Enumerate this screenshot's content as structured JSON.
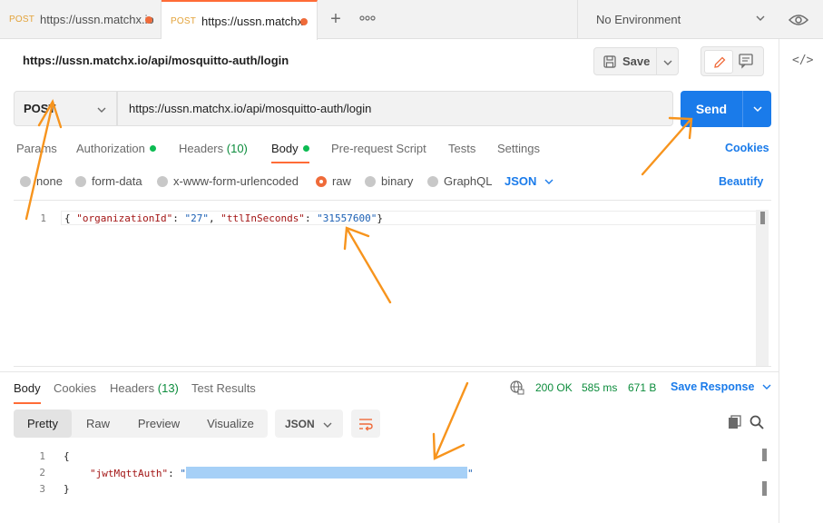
{
  "tabs": [
    {
      "method": "POST",
      "title": "https://ussn.matchx.io/api/mosquitto-auth/login"
    },
    {
      "method": "POST",
      "title": "https://ussn.matchx.io/api/mosquitto-auth/login"
    }
  ],
  "environment": {
    "selected": "No Environment"
  },
  "request": {
    "title": "https://ussn.matchx.io/api/mosquitto-auth/login",
    "save_label": "Save",
    "method": "POST",
    "url": "https://ussn.matchx.io/api/mosquitto-auth/login",
    "send_label": "Send"
  },
  "request_tabs": {
    "params": "Params",
    "authorization": "Authorization",
    "headers": "Headers",
    "headers_count": "(10)",
    "body": "Body",
    "prerequest": "Pre-request Script",
    "tests": "Tests",
    "settings": "Settings",
    "cookies": "Cookies"
  },
  "body_modes": {
    "none": "none",
    "form_data": "form-data",
    "urlencoded": "x-www-form-urlencoded",
    "raw": "raw",
    "binary": "binary",
    "graphql": "GraphQL",
    "language": "JSON",
    "beautify": "Beautify"
  },
  "request_body": {
    "line_number": "1",
    "open_brace": "{",
    "key1": "\"organizationId\"",
    "sep1": ": ",
    "val1": "\"27\"",
    "comma": ", ",
    "key2": "\"ttlInSeconds\"",
    "sep2": ": ",
    "val2": "\"31557600\"",
    "close_brace": "}"
  },
  "response": {
    "tabs": {
      "body": "Body",
      "cookies": "Cookies",
      "headers": "Headers",
      "headers_count": "(13)",
      "test_results": "Test Results"
    },
    "status": "200 OK",
    "time": "585 ms",
    "size": "671 B",
    "save_response": "Save Response",
    "views": {
      "pretty": "Pretty",
      "raw": "Raw",
      "preview": "Preview",
      "visualize": "Visualize"
    },
    "format": "JSON",
    "lines": {
      "n1": "1",
      "n2": "2",
      "n3": "3",
      "open_brace": "{",
      "key": "\"jwtMqttAuth\"",
      "sep": ": ",
      "quote_open": "\"",
      "quote_close": "\"",
      "close_brace": "}"
    }
  },
  "colors": {
    "accent_orange": "#ff6c37",
    "send_blue": "#1a7bea",
    "status_green": "#0c8c3c",
    "annotation_orange": "#f7941d"
  }
}
